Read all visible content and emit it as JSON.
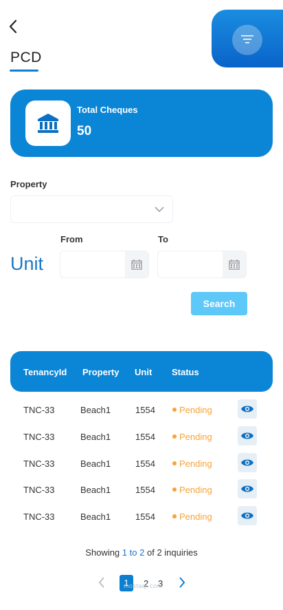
{
  "header": {
    "title": "PCD",
    "back_icon": "chevron-left-icon",
    "filter_icon": "filter-lines-icon"
  },
  "summary": {
    "label": "Total Cheques",
    "value": "50",
    "icon": "bank-building-icon"
  },
  "form": {
    "property_label": "Property",
    "property_value": "",
    "unit_label": "Unit",
    "from_label": "From",
    "to_label": "To",
    "from_value": "",
    "to_value": "",
    "search_label": "Search"
  },
  "table": {
    "columns": [
      "TenancyId",
      "Property",
      "Unit",
      "Status"
    ],
    "rows": [
      {
        "tenancy": "TNC-33",
        "property": "Beach1",
        "unit": "1554",
        "status": "Pending"
      },
      {
        "tenancy": "TNC-33",
        "property": "Beach1",
        "unit": "1554",
        "status": "Pending"
      },
      {
        "tenancy": "TNC-33",
        "property": "Beach1",
        "unit": "1554",
        "status": "Pending"
      },
      {
        "tenancy": "TNC-33",
        "property": "Beach1",
        "unit": "1554",
        "status": "Pending"
      },
      {
        "tenancy": "TNC-33",
        "property": "Beach1",
        "unit": "1554",
        "status": "Pending"
      }
    ]
  },
  "footer": {
    "showing_prefix": "Showing",
    "from": "1",
    "to_word": "to",
    "to": "2",
    "of_total": "of 2 inquiries"
  },
  "pagination": {
    "pages": [
      "1",
      "2",
      "3"
    ],
    "current": "1"
  },
  "watermark": "mostaql.com",
  "colors": {
    "primary": "#0b85d6",
    "accent_text": "#1b77c4",
    "search_button": "#5ec8f8",
    "pending": "#f6a23a"
  }
}
